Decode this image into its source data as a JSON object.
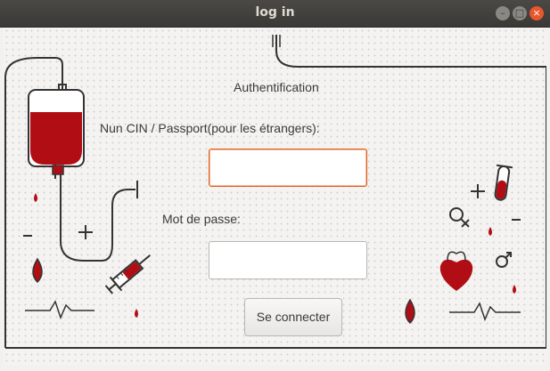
{
  "window": {
    "title": "log in"
  },
  "form": {
    "heading": "Authentification",
    "cin_label": "Nun CIN / Passport(pour les étrangers):",
    "cin_value": "",
    "password_label": "Mot de passe:",
    "password_value": "",
    "submit_label": "Se connecter"
  },
  "colors": {
    "accent": "#e0601c",
    "blood": "#b00e14",
    "line": "#333333"
  },
  "icons": [
    "blood-bag-icon",
    "syringe-icon",
    "blood-drop-icon",
    "heart-icon",
    "test-tube-icon",
    "female-symbol-icon",
    "male-symbol-icon",
    "plus-icon",
    "minus-icon",
    "heartbeat-line-icon"
  ]
}
